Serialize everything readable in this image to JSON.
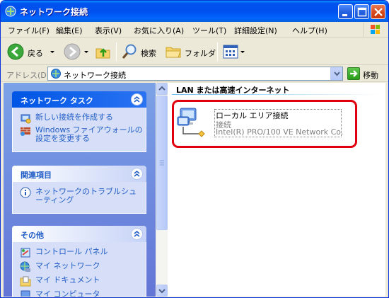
{
  "window": {
    "title": "ネットワーク接続",
    "buttons": {
      "minimize": "minimize",
      "maximize": "maximize",
      "close": "close"
    }
  },
  "menubar": {
    "items": [
      {
        "label": "ファイル(F)"
      },
      {
        "label": "編集(E)"
      },
      {
        "label": "表示(V)"
      },
      {
        "label": "お気に入り(A)"
      },
      {
        "label": "ツール(T)"
      },
      {
        "label": "詳細設定(N)"
      },
      {
        "label": "ヘルプ(H)"
      }
    ]
  },
  "toolbar": {
    "back_label": "戻る",
    "search_label": "検索",
    "folders_label": "フォルダ",
    "icons": [
      "back-icon",
      "forward-icon",
      "up-folder-icon",
      "search-icon",
      "folders-icon",
      "views-icon"
    ]
  },
  "addressbar": {
    "label": "アドレス(D)",
    "value": "ネットワーク接続",
    "go_label": "移動"
  },
  "taskpane": {
    "network_tasks": {
      "title": "ネットワーク タスク",
      "items": [
        {
          "label": "新しい接続を作成する",
          "icon": "new-connection-icon"
        },
        {
          "label": "Windows ファイアウォールの設定を変更する",
          "icon": "firewall-icon"
        }
      ]
    },
    "related": {
      "title": "関連項目",
      "items": [
        {
          "label": "ネットワークのトラブルシューティング",
          "icon": "info-icon"
        }
      ]
    },
    "other": {
      "title": "その他",
      "items": [
        {
          "label": "コントロール パネル",
          "icon": "control-panel-icon"
        },
        {
          "label": "マイ ネットワーク",
          "icon": "my-network-icon"
        },
        {
          "label": "マイ ドキュメント",
          "icon": "my-documents-icon"
        },
        {
          "label": "マイ コンピュータ",
          "icon": "my-computer-icon"
        }
      ]
    }
  },
  "main": {
    "group_title": "LAN または高速インターネット",
    "connection": {
      "name": "ローカル エリア接続",
      "status": "接続",
      "device": "Intel(R) PRO/100 VE Network Co..."
    }
  },
  "colors": {
    "title_bar": "#0054e3",
    "taskpane_bg": "#7ba2e7",
    "task_link": "#215dc6",
    "highlight": "#e0000e"
  }
}
